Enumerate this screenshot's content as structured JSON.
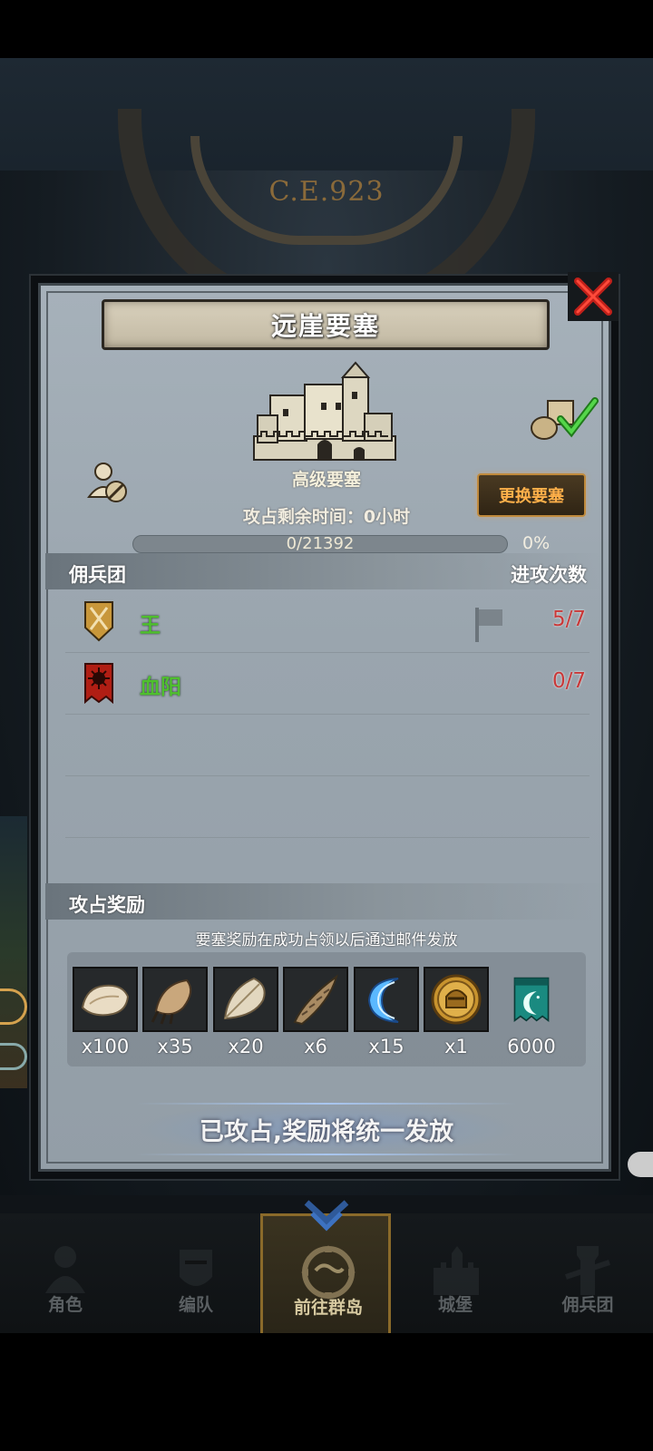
{
  "era": "C.E.923",
  "dialog": {
    "title": "远崖要塞",
    "fortress_type": "高级要塞",
    "swap_button": "更换要塞",
    "time_remaining": "攻占剩余时间：0小时",
    "progress_text": "0/21392",
    "progress_percent": "0%",
    "progress_value": 0
  },
  "mercenary_section": {
    "label": "佣兵团",
    "attacks_label": "进攻次数",
    "rows": [
      {
        "name": "王",
        "count": "5/7",
        "emblem": "crossed-swords-shield-icon"
      },
      {
        "name": "血阳",
        "count": "0/7",
        "emblem": "red-banner-icon"
      }
    ]
  },
  "reward_section": {
    "label": "攻占奖励",
    "note": "要塞奖励在成功占领以后通过邮件发放",
    "items": [
      {
        "icon": "fur-pelt-icon",
        "qty": "x100"
      },
      {
        "icon": "claw-icon",
        "qty": "x35"
      },
      {
        "icon": "feather-icon",
        "qty": "x20"
      },
      {
        "icon": "horn-icon",
        "qty": "x6"
      },
      {
        "icon": "blue-crescent-icon",
        "qty": "x15"
      },
      {
        "icon": "gold-helmet-coin-icon",
        "qty": "x1"
      },
      {
        "icon": "guild-banner-icon",
        "qty": "6000"
      }
    ]
  },
  "claim_text": "已攻占,奖励将统一发放",
  "nav": {
    "items": [
      {
        "label": "角色",
        "icon": "character-icon"
      },
      {
        "label": "编队",
        "icon": "formation-icon"
      },
      {
        "label": "前往群岛",
        "icon": "archipelago-icon"
      },
      {
        "label": "城堡",
        "icon": "castle-icon"
      },
      {
        "label": "佣兵团",
        "icon": "mercenary-icon"
      }
    ],
    "active_index": 2
  }
}
